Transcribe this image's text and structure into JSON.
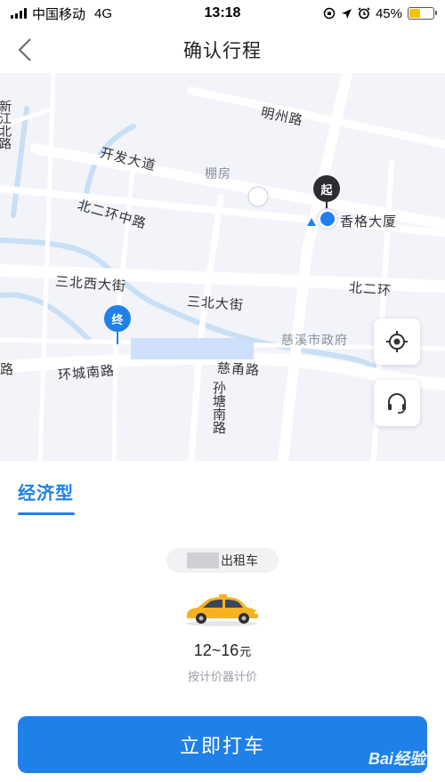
{
  "status_bar": {
    "carrier": "中国移动",
    "network": "4G",
    "time": "13:18",
    "battery_text": "45%",
    "battery_level": 0.45,
    "icons": [
      "signal-icon",
      "rotation-lock-icon",
      "location-arrow-icon",
      "alarm-icon",
      "battery-icon"
    ]
  },
  "nav": {
    "title": "确认行程",
    "back_icon": "chevron-left-icon"
  },
  "map": {
    "labels": {
      "mingzhou_road": "明州路",
      "kaifa_avenue": "开发大道",
      "pengfang": "棚房",
      "xiangge_building": "香格大厦",
      "beierhuan_middle": "北二环中路",
      "sanbei_west": "三北西大街",
      "sanbei_avenue": "三北大街",
      "beierhuan": "北二环",
      "cixi_government": "慈溪市政府",
      "huancheng_south": "环城南路",
      "ciyong_road": "慈甬路",
      "suntang_south": "孙塘南路",
      "left_edge_road": "新江北路",
      "left_edge_lu": "路"
    },
    "start_pin_label": "起",
    "end_pin_label": "终",
    "locate_icon": "crosshair-icon",
    "support_icon": "headset-icon"
  },
  "sheet": {
    "tab_label": "经济型",
    "vehicle_type": "出租车",
    "price_range": "12~16",
    "price_unit": "元",
    "price_note": "按计价器计价",
    "cta_label": "立即打车",
    "watermark": "Bai经验"
  },
  "colors": {
    "accent": "#1f80e8",
    "map_bg": "#f2f4f9",
    "road": "#ffffff",
    "river": "#c9dff5",
    "start_pin": "#2b2d33"
  }
}
